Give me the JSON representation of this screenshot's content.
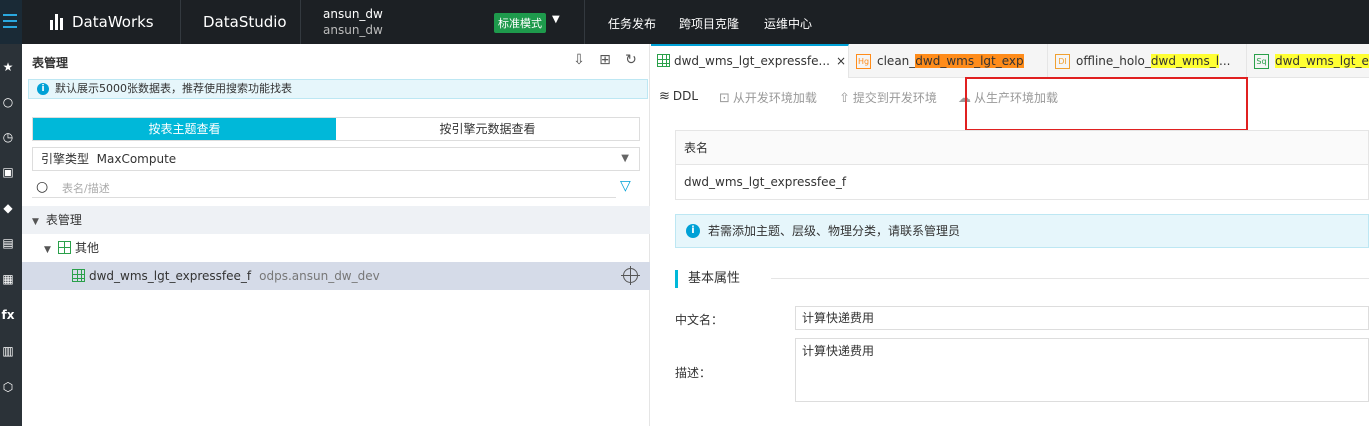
{
  "topbar": {
    "brand": "DataWorks",
    "module": "DataStudio",
    "project_name": "ansun_dw",
    "project_sub": "ansun_dw",
    "mode": "标准模式",
    "nav": [
      "任务发布",
      "跨项目克隆",
      "运维中心"
    ]
  },
  "table_panel": {
    "title": "表管理",
    "notice": "默认展示5000张数据表，推荐使用搜索功能找表",
    "view_tabs": [
      "按表主题查看",
      "按引擎元数据查看"
    ],
    "engine_label": "引擎类型",
    "engine_value": "MaxCompute",
    "search_placeholder": "表名/描述",
    "tree": {
      "root": "表管理",
      "category": "其他",
      "table_name": "dwd_wms_lgt_expressfee_f",
      "table_schema": "odps.ansun_dw_dev"
    }
  },
  "editor": {
    "tabs": [
      {
        "badge": "",
        "prefix": "dwd_wms_lgt_expressfe...",
        "highlight": "",
        "suffix": "",
        "close": "×"
      },
      {
        "badge": "Hg",
        "prefix": "clean_",
        "highlight": "dwd_wms_lgt_exp",
        "suffix": "",
        "close": ""
      },
      {
        "badge": "DI",
        "prefix": "offline_holo_",
        "highlight": "dwd_wms_l",
        "suffix": "...",
        "close": ""
      },
      {
        "badge": "Sq",
        "prefix": "",
        "highlight": "dwd_wms_lgt_ex",
        "suffix": "",
        "close": ""
      }
    ],
    "toolbar": {
      "ddl": "DDL",
      "load_dev": "从开发环境加载",
      "submit_dev": "提交到开发环境",
      "load_prod": "从生产环境加载"
    },
    "table_card": {
      "label": "表名",
      "value": "dwd_wms_lgt_expressfee_f"
    },
    "tip": "若需添加主题、层级、物理分类，请联系管理员",
    "section_title": "基本属性",
    "fields": {
      "cn_name_label": "中文名：",
      "cn_name_value": "计算快递费用",
      "desc_label": "描述：",
      "desc_value": "计算快递费用"
    }
  },
  "colors": {
    "accent": "#00b8d9",
    "highlight_orange": "#ff8c1a",
    "highlight_yellow": "#ffff33",
    "annotation_red": "#e02020"
  }
}
